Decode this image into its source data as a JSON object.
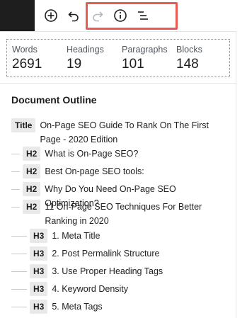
{
  "toolbar": {
    "buttons": [
      {
        "name": "add-block-button",
        "icon": "plus-circle-icon"
      },
      {
        "name": "undo-button",
        "icon": "undo-icon"
      },
      {
        "name": "redo-button",
        "icon": "redo-icon",
        "disabled": true
      },
      {
        "name": "info-button",
        "icon": "info-icon"
      },
      {
        "name": "outline-button",
        "icon": "list-view-icon"
      }
    ],
    "highlight_color": "#e85a4f"
  },
  "stats": [
    {
      "label": "Words",
      "value": "2691"
    },
    {
      "label": "Headings",
      "value": "19"
    },
    {
      "label": "Paragraphs",
      "value": "101"
    },
    {
      "label": "Blocks",
      "value": "148"
    }
  ],
  "outline": {
    "title": "Document Outline",
    "items": [
      {
        "level": "Title",
        "text": "On-Page SEO Guide To Rank On The First Page - 2020 Edition"
      },
      {
        "level": "H2",
        "text": "What is On-Page SEO?"
      },
      {
        "level": "H2",
        "text": "Best On-page SEO tools:"
      },
      {
        "level": "H2",
        "text": "Why Do You Need On-Page SEO Optimization?"
      },
      {
        "level": "H2",
        "text": "11 On-Page SEO Techniques For Better Ranking in 2020"
      },
      {
        "level": "H3",
        "text": "1. Meta Title"
      },
      {
        "level": "H3",
        "text": "2. Post Permalink Structure"
      },
      {
        "level": "H3",
        "text": "3. Use Proper Heading Tags"
      },
      {
        "level": "H3",
        "text": "4. Keyword Density"
      },
      {
        "level": "H3",
        "text": "5. Meta Tags"
      }
    ]
  }
}
